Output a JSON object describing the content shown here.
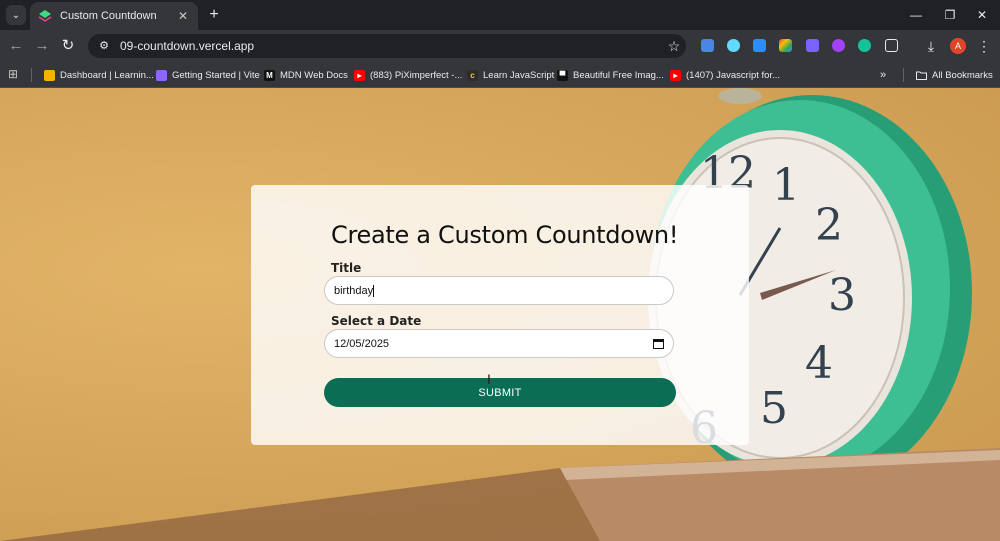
{
  "browser": {
    "tab": {
      "title": "Custom Countdown",
      "close": "✕"
    },
    "new_tab": "+",
    "window_controls": {
      "minimize": "—",
      "restore": "❐",
      "close": "✕"
    },
    "url": "09-countdown.vercel.app",
    "nav": {
      "back": "←",
      "forward": "→",
      "reload": "↻"
    },
    "profile_initial": "A"
  },
  "bookmarks": {
    "items": [
      {
        "label": "Dashboard | Learnin...",
        "icon": "bar-chart-icon",
        "color": "#f4b400"
      },
      {
        "label": "Getting Started | Vite",
        "icon": "vite-icon",
        "color": "#8d65ff"
      },
      {
        "label": "MDN Web Docs",
        "icon": "mdn-icon",
        "color": "#111111"
      },
      {
        "label": "(883) PiXimperfect -...",
        "icon": "youtube-icon",
        "color": "#ff0000"
      },
      {
        "label": "Learn JavaScript",
        "icon": "cc-icon",
        "color": "#2d2d2d"
      },
      {
        "label": "Beautiful Free Imag...",
        "icon": "unsplash-icon",
        "color": "#111111"
      },
      {
        "label": "(1407) Javascript for...",
        "icon": "youtube-icon",
        "color": "#ff0000"
      }
    ],
    "more": "»",
    "all_bookmarks": "All Bookmarks"
  },
  "form": {
    "heading": "Create a Custom Countdown!",
    "title_label": "Title",
    "title_value": "birthday",
    "date_label": "Select a Date",
    "date_value": "12/05/2025",
    "submit_label": "SUBMIT"
  },
  "colors": {
    "accent": "#0a6e55",
    "background": "#d6a75c",
    "clock_body": "#3dbf93"
  }
}
